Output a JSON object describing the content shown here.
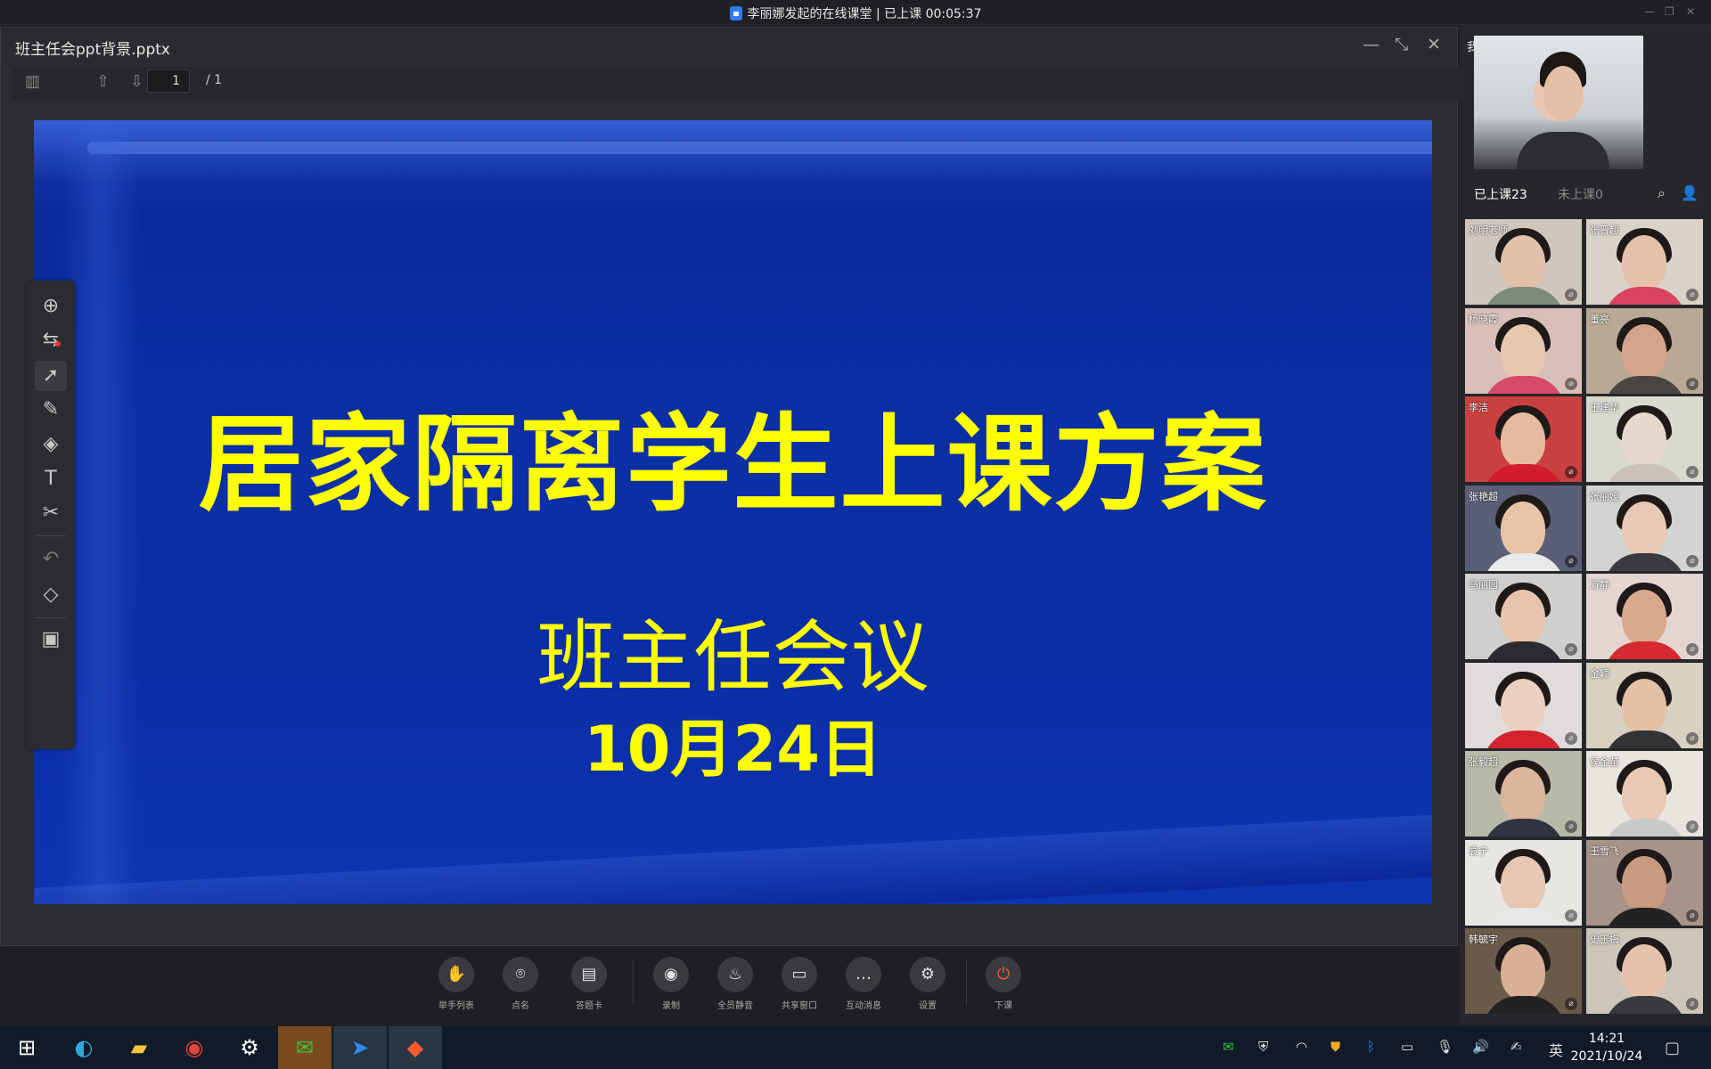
{
  "titlebar": {
    "text": "李丽娜发起的在线课堂 | 已上课 00:05:37",
    "minimize": "—",
    "restore": "❐",
    "close": "✕"
  },
  "viewer": {
    "filename": "班主任会ppt背景.pptx",
    "minimize": "—",
    "restore": "⤡",
    "close": "✕",
    "page_current": "1",
    "page_total": "/ 1"
  },
  "slide": {
    "title": "居家隔离学生上课方案",
    "subtitle": "班主任会议",
    "date": "10月24日",
    "text_color": "#ffff00",
    "background_color": "#0b2fa4"
  },
  "left_tools": [
    "add-page-icon",
    "ppt-control-icon",
    "pointer-icon",
    "pen-icon",
    "shapes-icon",
    "text-icon",
    "scissors-icon",
    "undo-icon",
    "eraser-icon",
    "toolbox-icon"
  ],
  "bottom_bar": {
    "items": [
      {
        "label": "举手列表",
        "icon": "hand-icon",
        "glyph": "✋"
      },
      {
        "label": "点名",
        "icon": "location-icon",
        "glyph": "⌾"
      },
      {
        "label": "答题卡",
        "icon": "answer-card-icon",
        "glyph": "▤"
      },
      {
        "label": "录制",
        "icon": "record-icon",
        "glyph": "◉"
      },
      {
        "label": "全员静音",
        "icon": "mute-all-icon",
        "glyph": "♨"
      },
      {
        "label": "共享窗口",
        "icon": "share-window-icon",
        "glyph": "▭"
      },
      {
        "label": "互动消息",
        "icon": "message-icon",
        "glyph": "…"
      },
      {
        "label": "设置",
        "icon": "settings-icon",
        "glyph": "⚙"
      },
      {
        "label": "下课",
        "icon": "power-icon",
        "glyph": "⏻"
      }
    ],
    "end_color": "#ff5a2e"
  },
  "right_panel": {
    "me_label": "我",
    "tab_attending": "已上课23",
    "tab_absent": "未上课0",
    "participants": [
      {
        "name": "刘明老师"
      },
      {
        "name": "张晋超"
      },
      {
        "name": "杨晓霞"
      },
      {
        "name": "董亮"
      },
      {
        "name": "李洁"
      },
      {
        "name": "王建华"
      },
      {
        "name": "张艳超"
      },
      {
        "name": "张丽媛"
      },
      {
        "name": "马丽园"
      },
      {
        "name": "万静"
      },
      {
        "name": ""
      },
      {
        "name": "金颖"
      },
      {
        "name": "张毅超"
      },
      {
        "name": "侯金苗"
      },
      {
        "name": "袁宁"
      },
      {
        "name": "王雪飞"
      },
      {
        "name": "韩毓宇"
      },
      {
        "name": "史玉梅"
      }
    ]
  },
  "taskbar": {
    "apps": [
      {
        "icon": "windows-start-icon",
        "glyph": "⊞",
        "color": "#ffffff"
      },
      {
        "icon": "edge-icon",
        "glyph": "◐",
        "color": "#2fa7e0"
      },
      {
        "icon": "file-explorer-icon",
        "glyph": "▰",
        "color": "#f3c53b"
      },
      {
        "icon": "chrome-icon",
        "glyph": "◉",
        "color": "#e0483a"
      },
      {
        "icon": "settings-gear-icon",
        "glyph": "⚙",
        "color": "#ffffff"
      },
      {
        "icon": "wechat-icon",
        "glyph": "✉",
        "color": "#3cc24a"
      },
      {
        "icon": "dingtalk-icon",
        "glyph": "➤",
        "color": "#2f8cf6"
      },
      {
        "icon": "classroom-app-icon",
        "glyph": "◆",
        "color": "#ff5a2e"
      }
    ],
    "ime": "英",
    "time": "14:21",
    "date": "2021/10/24"
  }
}
